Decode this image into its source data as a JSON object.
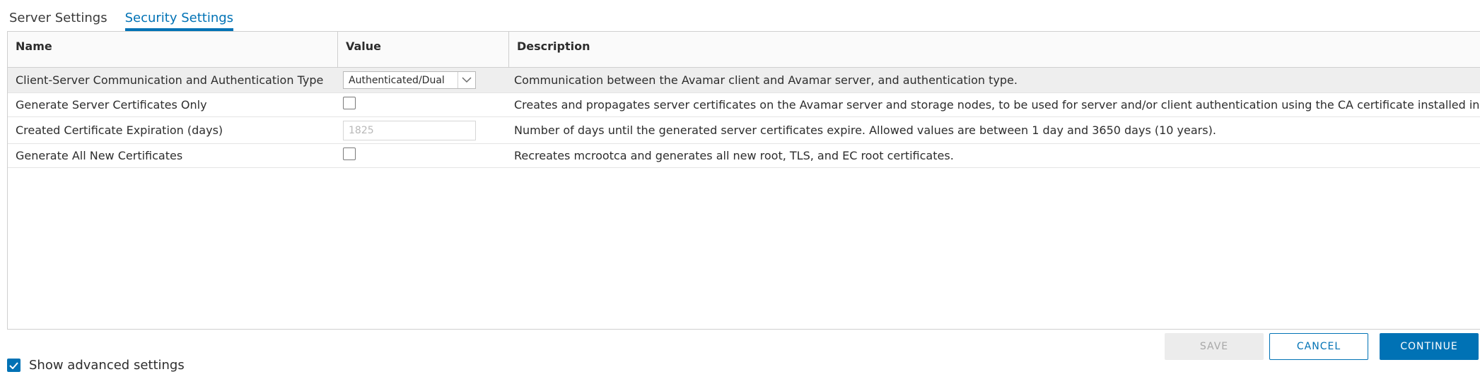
{
  "tabs": [
    {
      "label": "Server Settings"
    },
    {
      "label": "Security Settings"
    }
  ],
  "table": {
    "columns": [
      "Name",
      "Value",
      "Description"
    ],
    "rows": [
      {
        "name": "Client-Server Communication and Authentication Type",
        "value": "Authenticated/Dual",
        "description": "Communication between the Avamar client and Avamar server, and authentication type."
      },
      {
        "name": "Generate Server Certificates Only",
        "value": "",
        "description": "Creates and propagates server certificates on the Avamar server and storage nodes, to be used for server and/or client authentication using the CA certificate installed in the k"
      },
      {
        "name": "Created Certificate Expiration (days)",
        "placeholder": "1825",
        "description": "Number of days until the generated server certificates expire. Allowed values are between 1 day and 3650 days (10 years)."
      },
      {
        "name": "Generate All New Certificates",
        "value": "",
        "description": "Recreates mcrootca and generates all new root, TLS, and EC root certificates."
      }
    ]
  },
  "buttons": {
    "save": "SAVE",
    "cancel": "CANCEL",
    "continue": "CONTINUE"
  },
  "advanced": {
    "label": "Show advanced settings"
  },
  "colors": {
    "accent": "#0072b5",
    "selected_row": "#eeeeee",
    "disabled_button": "#ececec"
  }
}
